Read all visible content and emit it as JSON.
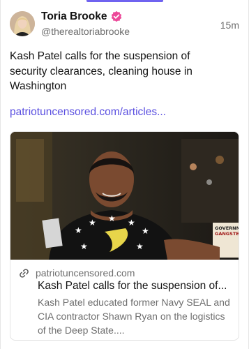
{
  "author": {
    "name": "Toria Brooke",
    "handle": "@therealtoriabrooke",
    "verified": true
  },
  "post": {
    "time": "15m",
    "text": "Kash Patel calls for the suspension of security clearances, cleaning house in Washington",
    "link_text": "patriotuncensored.com/articles..."
  },
  "link_card": {
    "domain": "patriotuncensored.com",
    "title": "Kash Patel calls for the suspension of...",
    "description": "Kash Patel educated former Navy SEAL and CIA contractor Shawn Ryan on the logistics of the Deep State....",
    "image_sign_text": "GOVERNMENT GANGSTERS"
  },
  "colors": {
    "accent": "#6f63f0",
    "link": "#5a4fe0",
    "verified_badge": "#ec4899"
  },
  "icons": {
    "verified": "verified-badge-icon",
    "link": "link-icon"
  }
}
